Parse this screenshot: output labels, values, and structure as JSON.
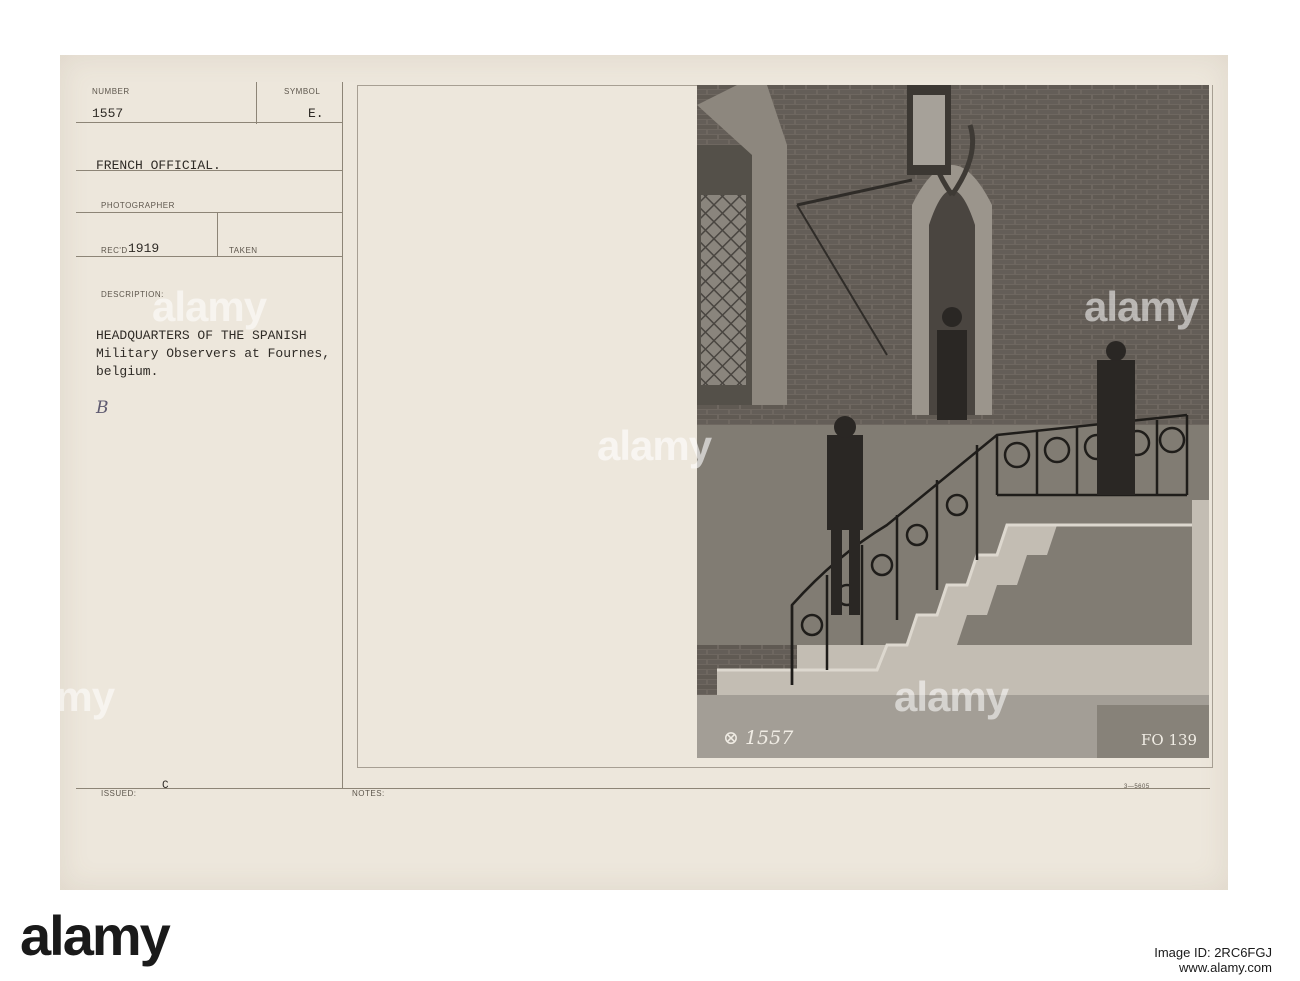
{
  "card": {
    "number_label": "NUMBER",
    "number": "1557",
    "symbol_label": "SYMBOL",
    "symbol": "E.",
    "source": "FRENCH OFFICIAL.",
    "photographer_label": "PHOTOGRAPHER",
    "recd_label": "REC'D",
    "recd_year": "1919",
    "taken_label": "TAKEN",
    "description_label": "DESCRIPTION:",
    "description_lines": [
      "HEADQUARTERS OF THE SPANISH",
      "Military Observers at Fournes,",
      "belgium."
    ],
    "handwritten_mark": "B",
    "issued_label": "ISSUED:",
    "issued_value": "C",
    "notes_label": "NOTES:",
    "form_code": "3—5605"
  },
  "photo": {
    "negative_number": "⊗ 1557",
    "file_code": "FO 139"
  },
  "watermarks": [
    "alamy",
    "alamy",
    "alamy",
    "alamy",
    "alamy",
    "alamy"
  ],
  "footer": {
    "brand": "alamy",
    "image_id_line": "Image ID: 2RC6FGJ",
    "url": "www.alamy.com"
  },
  "colors": {
    "card": "#ede7dc",
    "ink": "#2f2b26",
    "photo_dark": "#3a3733"
  }
}
